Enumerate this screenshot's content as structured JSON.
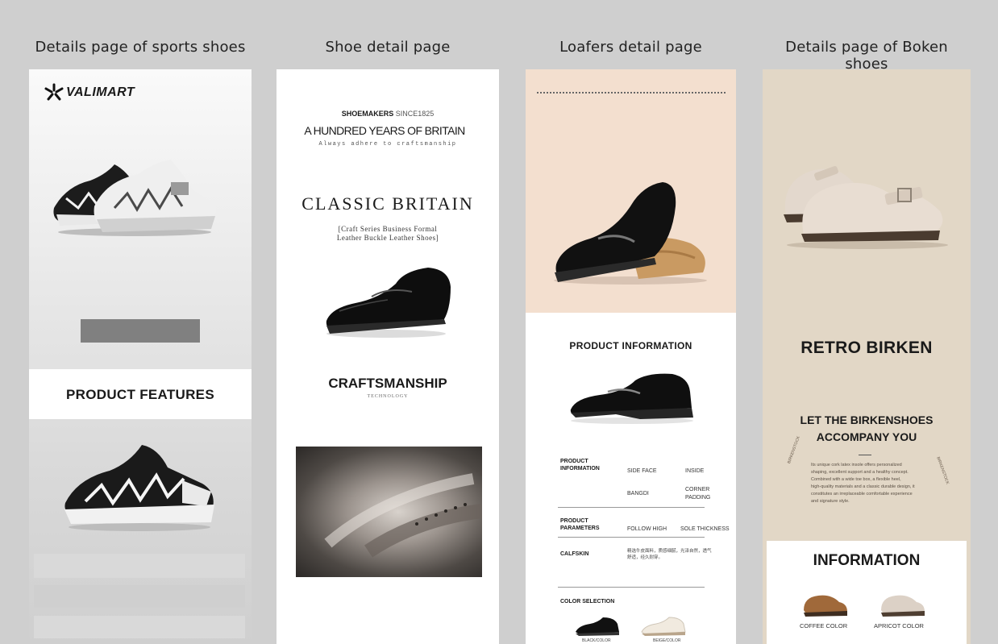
{
  "headers": {
    "col1": "Details page of sports shoes",
    "col2": "Shoe detail page",
    "col3": "Loafers detail page",
    "col4": "Details page of Boken shoes"
  },
  "sports": {
    "brand": "VALIMART",
    "features_heading": "PRODUCT FEATURES"
  },
  "shoe": {
    "brand_bold": "SHOEMAKERS",
    "brand_since": "SINCE1825",
    "headline": "A HUNDRED YEARS OF BRITAIN",
    "tagline": "Always adhere to craftsmanship",
    "collection": "CLASSIC BRITAIN",
    "series_line1": "[Craft Series Business Formal",
    "series_line2": "Leather Buckle Leather Shoes]",
    "craft_heading": "CRAFTSMANSHIP",
    "craft_sub": "TECHNOLOGY"
  },
  "loafers": {
    "info_heading": "PRODUCT INFORMATION",
    "table": {
      "row1_label_1": "PRODUCT",
      "row1_label_2": "INFORMATION",
      "row1_a": "SIDE FACE",
      "row1_b": "INSIDE",
      "row1_c": "BANGDI",
      "row1_d1": "CORNER",
      "row1_d2": "PADDING",
      "row2_label_1": "PRODUCT",
      "row2_label_2": "PARAMETERS",
      "row2_a": "FOLLOW HIGH",
      "row2_b": "SOLE THICKNESS",
      "row3_label": "CALFSKIN",
      "row3_text": "精选牛皮面料，质感细腻，光泽自然，透气舒适，经久耐穿。",
      "color_label": "COLOR SELECTION",
      "color_1": "BLACK/COLOR",
      "color_2": "BEIGE/COLOR"
    }
  },
  "boken": {
    "title": "RETRO BIRKEN",
    "subtitle_1": "LET THE BIRKENSHOES",
    "subtitle_2": "ACCOMPANY YOU",
    "stamp_left": "BIRKENSTOCK",
    "stamp_right": "BIRKENSTOCK",
    "body_1": "Its unique cork latex insole offers personalized",
    "body_2": "shaping, excellent support and a healthy concept.",
    "body_3": "Combined with a wide toe box, a flexible heel,",
    "body_4": "high-quality materials and a classic durable design, it",
    "body_5": "constitutes an irreplaceable comfortable experience",
    "body_6": "and signature style.",
    "info_heading": "INFORMATION",
    "color_1": "COFFEE COLOR",
    "color_2": "APRICOT COLOR"
  }
}
